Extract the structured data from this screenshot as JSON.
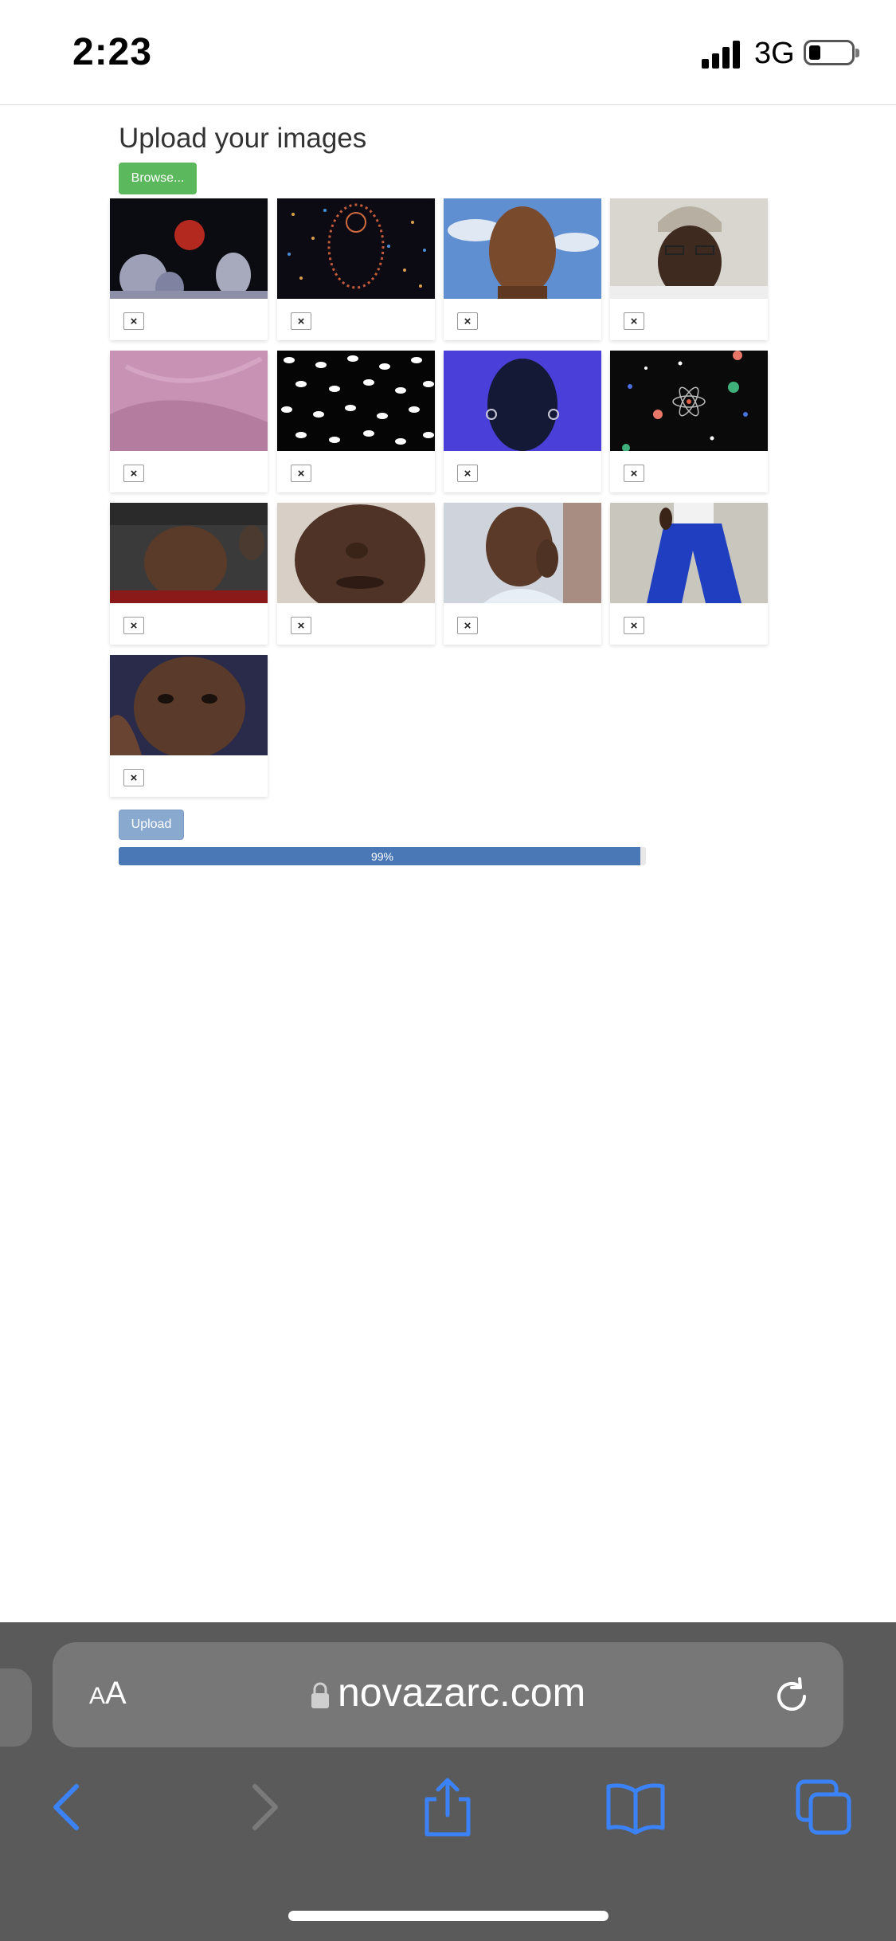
{
  "status_bar": {
    "time": "2:23",
    "network": "3G",
    "battery_level": 0.2
  },
  "page": {
    "title": "Upload your images",
    "browse_label": "Browse...",
    "remove_label": "×",
    "thumbnails": [
      {
        "icon": "moon-statues-image"
      },
      {
        "icon": "sparkle-figure-image"
      },
      {
        "icon": "portrait-sky-image"
      },
      {
        "icon": "portrait-cap-image"
      },
      {
        "icon": "pink-fabric-image"
      },
      {
        "icon": "eyes-pattern-image"
      },
      {
        "icon": "blue-portrait-image"
      },
      {
        "icon": "atom-dots-image"
      },
      {
        "icon": "selfie-image"
      },
      {
        "icon": "face-closeup-image"
      },
      {
        "icon": "hand-face-image"
      },
      {
        "icon": "blue-trousers-image"
      },
      {
        "icon": "hand-face-image-2"
      }
    ],
    "upload_label": "Upload",
    "progress_value": 99,
    "progress_text": "99%"
  },
  "browser": {
    "text_size_label_small": "A",
    "text_size_label_large": "A",
    "url": "novazarc.com"
  },
  "colors": {
    "browse_button": "#5cb85c",
    "upload_button": "#8aa9cf",
    "progress_fill": "#4a78b6",
    "toolbar_icon": "#3b82f6",
    "toolbar_background": "#5a5a5a"
  }
}
